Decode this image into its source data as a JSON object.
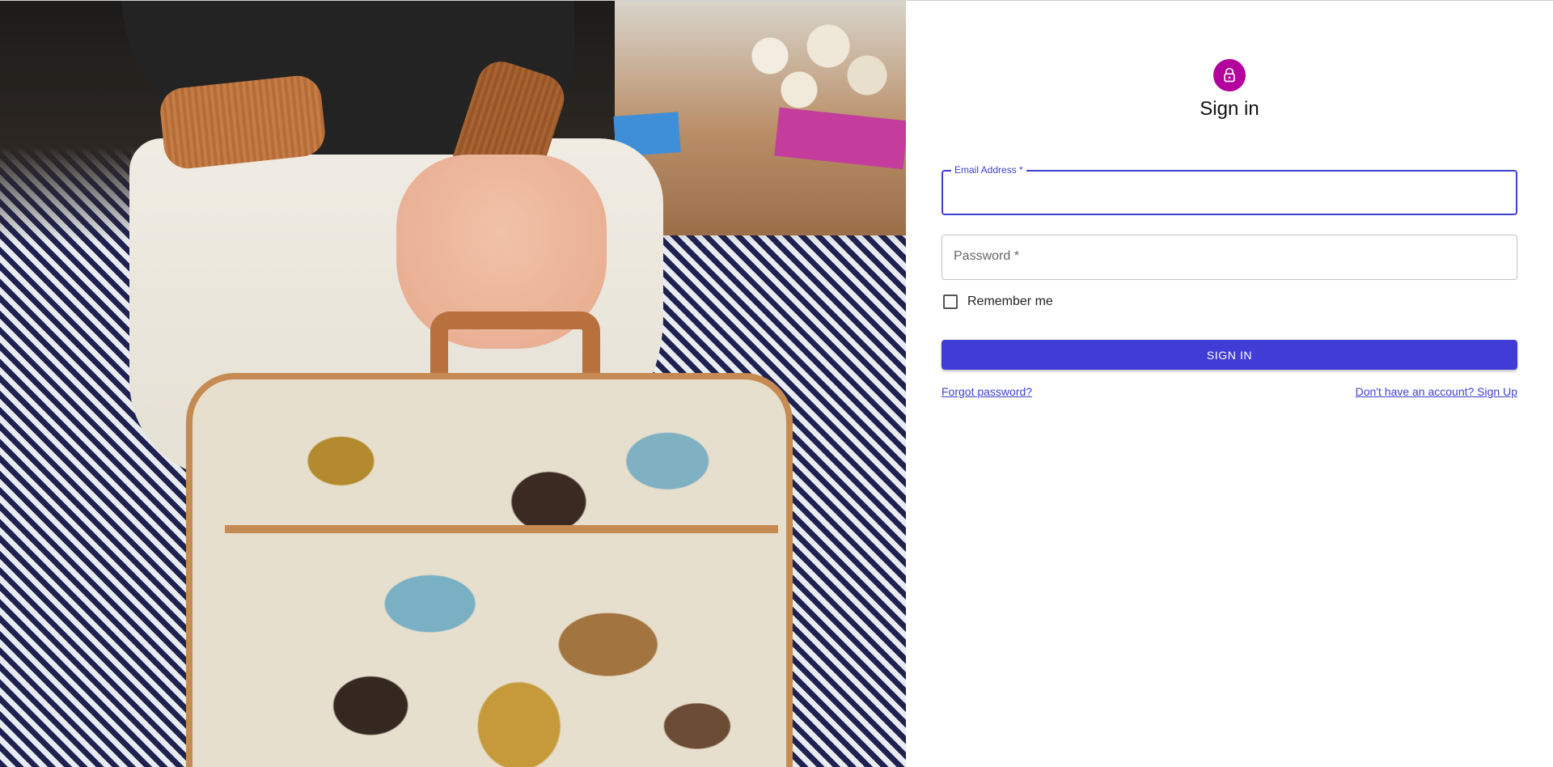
{
  "hero": {
    "image_description_icon": "suitcase-photo"
  },
  "signin": {
    "title": "Sign in",
    "avatar_icon": "lock-icon",
    "email": {
      "label": "Email Address *",
      "value": ""
    },
    "password": {
      "label": "Password *",
      "value": ""
    },
    "remember_label": "Remember me",
    "remember_checked": false,
    "submit_label": "SIGN IN",
    "forgot_link": "Forgot password?",
    "signup_link": "Don't have an account? Sign Up"
  },
  "colors": {
    "primary": "#413cd6",
    "avatar_bg": "#b4009c",
    "link": "#3f3fcf"
  }
}
